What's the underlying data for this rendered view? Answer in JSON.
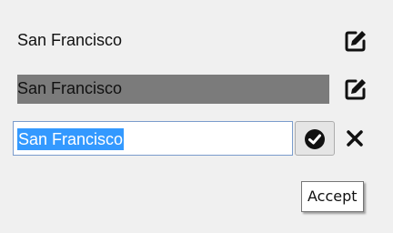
{
  "rows": [
    {
      "label": "San Francisco",
      "state": "view",
      "edit_icon": "edit-icon"
    },
    {
      "label": "San Francisco",
      "state": "hover",
      "edit_icon": "edit-icon"
    }
  ],
  "editor": {
    "value": "San Francisco",
    "accept_icon": "check-circle-icon",
    "cancel_icon": "close-icon"
  },
  "tooltip": {
    "text": "Accept"
  },
  "colors": {
    "background": "#f0f0f0",
    "hover_highlight": "#7b7b7b",
    "selection": "#3399ff",
    "input_border": "#7a9ccc"
  }
}
